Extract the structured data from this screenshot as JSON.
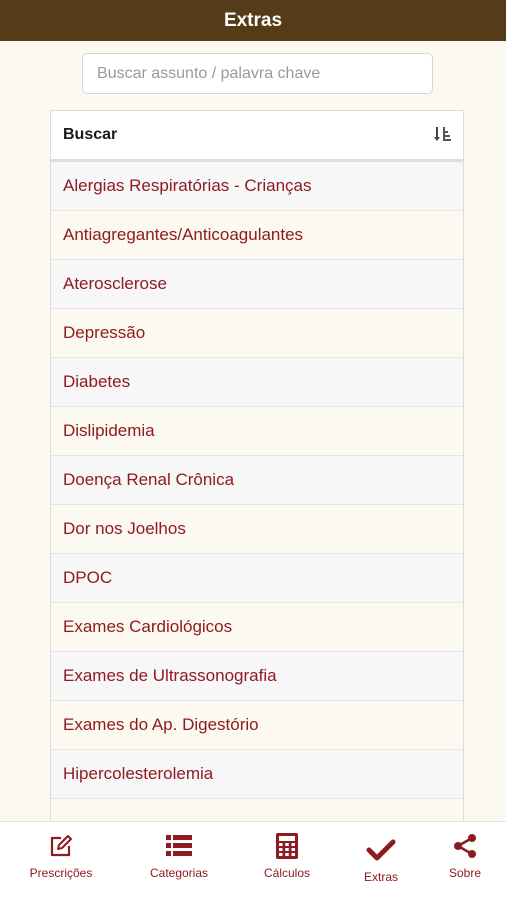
{
  "header": {
    "title": "Extras"
  },
  "search": {
    "placeholder": "Buscar assunto / palavra chave",
    "value": ""
  },
  "table": {
    "column_label": "Buscar",
    "sort_icon": "sort-alpha-icon",
    "rows": [
      "Alergias Respiratórias - Crianças",
      "Antiagregantes/Anticoagulantes",
      "Aterosclerose",
      "Depressão",
      "Diabetes",
      "Dislipidemia",
      "Doença Renal Crônica",
      "Dor nos Joelhos",
      "DPOC",
      "Exames Cardiológicos",
      "Exames de Ultrassonografia",
      "Exames do Ap. Digestório",
      "Hipercolesterolemia"
    ]
  },
  "nav": {
    "items": [
      {
        "label": "Prescrições",
        "icon": "edit-icon"
      },
      {
        "label": "Categorias",
        "icon": "list-icon"
      },
      {
        "label": "Cálculos",
        "icon": "calculator-icon"
      },
      {
        "label": "Extras",
        "icon": "check-icon",
        "active": true
      },
      {
        "label": "Sobre",
        "icon": "share-icon"
      }
    ]
  },
  "colors": {
    "top_bar": "#553b17",
    "accent": "#8e1b22",
    "background": "#fcfaf0"
  }
}
